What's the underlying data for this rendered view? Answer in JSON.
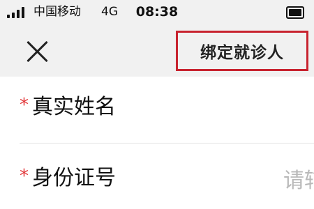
{
  "status_bar": {
    "carrier": "中国移动",
    "network": "4G",
    "time": "08:38"
  },
  "header": {
    "close_icon": "close-icon",
    "bind_label": "绑定就诊人"
  },
  "form": {
    "fields": [
      {
        "required_mark": "*",
        "label": "真实姓名"
      },
      {
        "required_mark": "*",
        "label": "身份证号",
        "placeholder": "请辅"
      }
    ]
  },
  "colors": {
    "highlight_border": "#c8232f",
    "required": "#e2393b",
    "placeholder": "#b9b9b9",
    "header_bg": "#f1f1f1"
  }
}
